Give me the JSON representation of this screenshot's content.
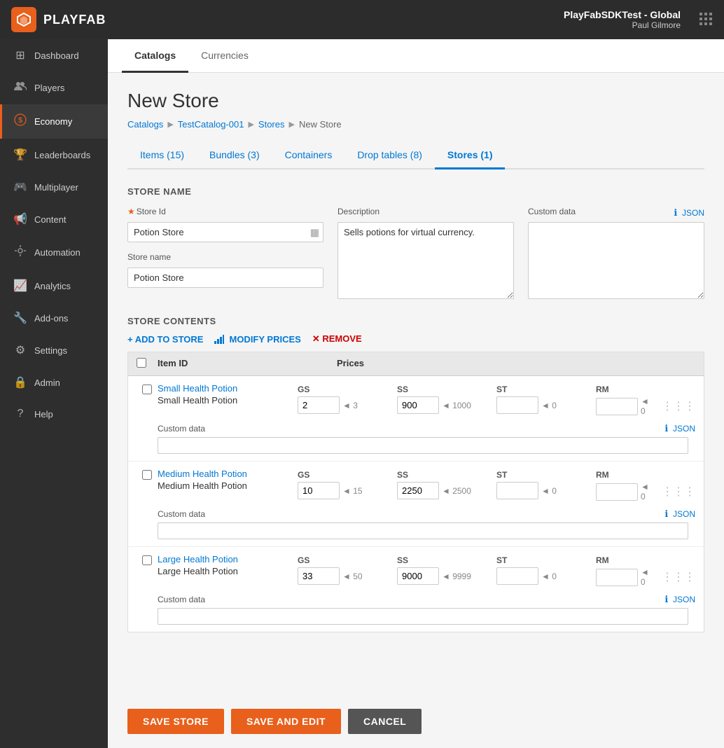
{
  "topbar": {
    "logo_text": "PLAYFAB",
    "env": "PlayFabSDKTest - Global",
    "user": "Paul Gilmore"
  },
  "sidebar": {
    "items": [
      {
        "id": "dashboard",
        "label": "Dashboard",
        "icon": "⊞"
      },
      {
        "id": "players",
        "label": "Players",
        "icon": "👥"
      },
      {
        "id": "economy",
        "label": "Economy",
        "icon": "$",
        "active": true
      },
      {
        "id": "leaderboards",
        "label": "Leaderboards",
        "icon": "🏆"
      },
      {
        "id": "multiplayer",
        "label": "Multiplayer",
        "icon": "🎮"
      },
      {
        "id": "content",
        "label": "Content",
        "icon": "📢"
      },
      {
        "id": "automation",
        "label": "Automation",
        "icon": "⚙"
      },
      {
        "id": "analytics",
        "label": "Analytics",
        "icon": "📈"
      },
      {
        "id": "addons",
        "label": "Add-ons",
        "icon": "🔧"
      },
      {
        "id": "settings",
        "label": "Settings",
        "icon": "⚙"
      },
      {
        "id": "admin",
        "label": "Admin",
        "icon": "🔒"
      },
      {
        "id": "help",
        "label": "Help",
        "icon": "?"
      }
    ]
  },
  "sub_tabs": [
    {
      "label": "Catalogs",
      "active": true
    },
    {
      "label": "Currencies",
      "active": false
    }
  ],
  "page": {
    "title": "New Store",
    "breadcrumb": [
      "Catalogs",
      "TestCatalog-001",
      "Stores",
      "New Store"
    ]
  },
  "nav_tabs": [
    {
      "label": "Items (15)"
    },
    {
      "label": "Bundles (3)"
    },
    {
      "label": "Containers"
    },
    {
      "label": "Drop tables (8)"
    },
    {
      "label": "Stores (1)",
      "active": true
    }
  ],
  "form": {
    "store_name_section": "STORE NAME",
    "store_id_label": "Store Id",
    "store_id_value": "Potion Store",
    "store_name_label": "Store name",
    "store_name_value": "Potion Store",
    "description_label": "Description",
    "description_value": "Sells potions for virtual currency.",
    "custom_data_label": "Custom data",
    "json_label": "JSON",
    "info_label": "ℹ"
  },
  "store_contents": {
    "section_label": "STORE CONTENTS",
    "add_label": "+ ADD TO STORE",
    "modify_label": "MODIFY PRICES",
    "remove_label": "✕ REMOVE",
    "col_item_id": "Item ID",
    "col_prices": "Prices",
    "items": [
      {
        "id": "Small Health Potion",
        "subtitle": "Small Health Potion",
        "gs_value": "2",
        "gs_hint": "◄ 3",
        "ss_value": "900",
        "ss_hint": "◄ 1000",
        "st_value": "",
        "st_hint": "◄ 0",
        "rm_value": "",
        "rm_hint": "◄ 0"
      },
      {
        "id": "Medium Health Potion",
        "subtitle": "Medium Health Potion",
        "gs_value": "10",
        "gs_hint": "◄ 15",
        "ss_value": "2250",
        "ss_hint": "◄ 2500",
        "st_value": "",
        "st_hint": "◄ 0",
        "rm_value": "",
        "rm_hint": "◄ 0"
      },
      {
        "id": "Large Health Potion",
        "subtitle": "Large Health Potion",
        "gs_value": "33",
        "gs_hint": "◄ 50",
        "ss_value": "9000",
        "ss_hint": "◄ 9999",
        "st_value": "",
        "st_hint": "◄ 0",
        "rm_value": "",
        "rm_hint": "◄ 0"
      }
    ]
  },
  "buttons": {
    "save_store": "SAVE STORE",
    "save_edit": "SAVE AND EDIT",
    "cancel": "CANCEL"
  }
}
